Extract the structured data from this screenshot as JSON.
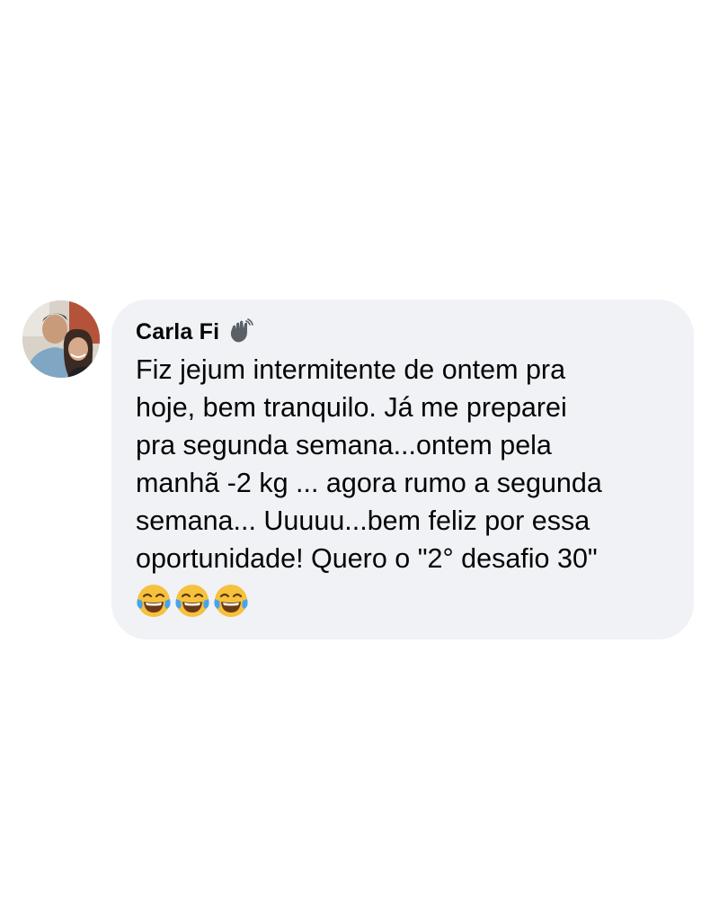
{
  "comment": {
    "author": "Carla Fi",
    "author_badge_icon": "waving-hand-icon",
    "text": "Fiz jejum intermitente de ontem pra\nhoje, bem tranquilo. Já me preparei\npra segunda semana...ontem pela\nmanhã  -2 kg ... agora rumo a segunda\nsemana... Uuuuu...bem feliz por essa\noportunidade! Quero o \"2° desafio 30\"",
    "emojis": [
      "😂",
      "😂",
      "😂"
    ]
  },
  "colors": {
    "bubble_background": "#f0f2f5",
    "text": "#050505",
    "page_background": "#ffffff"
  }
}
